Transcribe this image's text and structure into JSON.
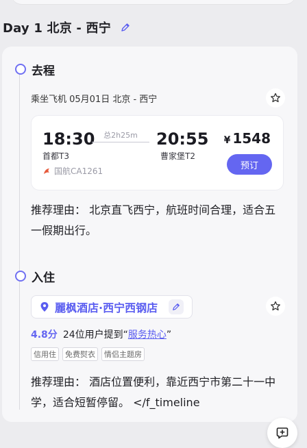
{
  "day": {
    "title": "Day 1 北京 - 西宁"
  },
  "departure": {
    "title": "去程",
    "summary": "乘坐飞机 05月01日 北京 - 西宁",
    "flight": {
      "dep_time": "18:30",
      "dep_airport": "首都T3",
      "duration": "总2h25m",
      "arr_time": "20:55",
      "arr_airport": "曹家堡T2",
      "airline": "国航CA1261",
      "currency": "¥",
      "price": "1548",
      "book_label": "预订"
    },
    "reason": "推荐理由： 北京直飞西宁，航班时间合理，适合五一假期出行。"
  },
  "stay": {
    "title": "入住",
    "hotel_name": "麗枫酒店·西宁西钢店",
    "score": "4.8分",
    "mention_prefix": "24位用户提到“",
    "mention_highlight": "服务热心",
    "mention_suffix": "”",
    "tags": [
      "信用住",
      "免费熨衣",
      "情侣主题房"
    ],
    "reason": "推荐理由： 酒店位置便利，靠近西宁市第二十一中学，适合短暂停留。 </f_timeline"
  },
  "colors": {
    "accent": "#6466f1",
    "background": "#ececef",
    "card": "#f7f7f9"
  },
  "icons": [
    "edit-icon",
    "star-icon",
    "location-pin-icon",
    "airline-logo-icon",
    "add-chat-icon"
  ]
}
